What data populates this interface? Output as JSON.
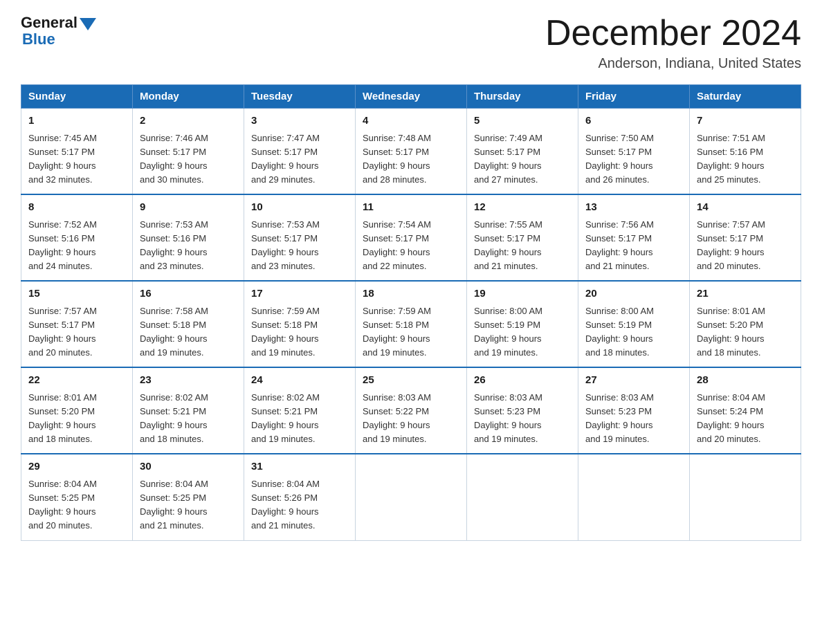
{
  "header": {
    "logo_general": "General",
    "logo_blue": "Blue",
    "month_title": "December 2024",
    "location": "Anderson, Indiana, United States"
  },
  "days_of_week": [
    "Sunday",
    "Monday",
    "Tuesday",
    "Wednesday",
    "Thursday",
    "Friday",
    "Saturday"
  ],
  "weeks": [
    [
      {
        "day": "1",
        "sunrise": "7:45 AM",
        "sunset": "5:17 PM",
        "daylight": "9 hours and 32 minutes."
      },
      {
        "day": "2",
        "sunrise": "7:46 AM",
        "sunset": "5:17 PM",
        "daylight": "9 hours and 30 minutes."
      },
      {
        "day": "3",
        "sunrise": "7:47 AM",
        "sunset": "5:17 PM",
        "daylight": "9 hours and 29 minutes."
      },
      {
        "day": "4",
        "sunrise": "7:48 AM",
        "sunset": "5:17 PM",
        "daylight": "9 hours and 28 minutes."
      },
      {
        "day": "5",
        "sunrise": "7:49 AM",
        "sunset": "5:17 PM",
        "daylight": "9 hours and 27 minutes."
      },
      {
        "day": "6",
        "sunrise": "7:50 AM",
        "sunset": "5:17 PM",
        "daylight": "9 hours and 26 minutes."
      },
      {
        "day": "7",
        "sunrise": "7:51 AM",
        "sunset": "5:16 PM",
        "daylight": "9 hours and 25 minutes."
      }
    ],
    [
      {
        "day": "8",
        "sunrise": "7:52 AM",
        "sunset": "5:16 PM",
        "daylight": "9 hours and 24 minutes."
      },
      {
        "day": "9",
        "sunrise": "7:53 AM",
        "sunset": "5:16 PM",
        "daylight": "9 hours and 23 minutes."
      },
      {
        "day": "10",
        "sunrise": "7:53 AM",
        "sunset": "5:17 PM",
        "daylight": "9 hours and 23 minutes."
      },
      {
        "day": "11",
        "sunrise": "7:54 AM",
        "sunset": "5:17 PM",
        "daylight": "9 hours and 22 minutes."
      },
      {
        "day": "12",
        "sunrise": "7:55 AM",
        "sunset": "5:17 PM",
        "daylight": "9 hours and 21 minutes."
      },
      {
        "day": "13",
        "sunrise": "7:56 AM",
        "sunset": "5:17 PM",
        "daylight": "9 hours and 21 minutes."
      },
      {
        "day": "14",
        "sunrise": "7:57 AM",
        "sunset": "5:17 PM",
        "daylight": "9 hours and 20 minutes."
      }
    ],
    [
      {
        "day": "15",
        "sunrise": "7:57 AM",
        "sunset": "5:17 PM",
        "daylight": "9 hours and 20 minutes."
      },
      {
        "day": "16",
        "sunrise": "7:58 AM",
        "sunset": "5:18 PM",
        "daylight": "9 hours and 19 minutes."
      },
      {
        "day": "17",
        "sunrise": "7:59 AM",
        "sunset": "5:18 PM",
        "daylight": "9 hours and 19 minutes."
      },
      {
        "day": "18",
        "sunrise": "7:59 AM",
        "sunset": "5:18 PM",
        "daylight": "9 hours and 19 minutes."
      },
      {
        "day": "19",
        "sunrise": "8:00 AM",
        "sunset": "5:19 PM",
        "daylight": "9 hours and 19 minutes."
      },
      {
        "day": "20",
        "sunrise": "8:00 AM",
        "sunset": "5:19 PM",
        "daylight": "9 hours and 18 minutes."
      },
      {
        "day": "21",
        "sunrise": "8:01 AM",
        "sunset": "5:20 PM",
        "daylight": "9 hours and 18 minutes."
      }
    ],
    [
      {
        "day": "22",
        "sunrise": "8:01 AM",
        "sunset": "5:20 PM",
        "daylight": "9 hours and 18 minutes."
      },
      {
        "day": "23",
        "sunrise": "8:02 AM",
        "sunset": "5:21 PM",
        "daylight": "9 hours and 18 minutes."
      },
      {
        "day": "24",
        "sunrise": "8:02 AM",
        "sunset": "5:21 PM",
        "daylight": "9 hours and 19 minutes."
      },
      {
        "day": "25",
        "sunrise": "8:03 AM",
        "sunset": "5:22 PM",
        "daylight": "9 hours and 19 minutes."
      },
      {
        "day": "26",
        "sunrise": "8:03 AM",
        "sunset": "5:23 PM",
        "daylight": "9 hours and 19 minutes."
      },
      {
        "day": "27",
        "sunrise": "8:03 AM",
        "sunset": "5:23 PM",
        "daylight": "9 hours and 19 minutes."
      },
      {
        "day": "28",
        "sunrise": "8:04 AM",
        "sunset": "5:24 PM",
        "daylight": "9 hours and 20 minutes."
      }
    ],
    [
      {
        "day": "29",
        "sunrise": "8:04 AM",
        "sunset": "5:25 PM",
        "daylight": "9 hours and 20 minutes."
      },
      {
        "day": "30",
        "sunrise": "8:04 AM",
        "sunset": "5:25 PM",
        "daylight": "9 hours and 21 minutes."
      },
      {
        "day": "31",
        "sunrise": "8:04 AM",
        "sunset": "5:26 PM",
        "daylight": "9 hours and 21 minutes."
      },
      null,
      null,
      null,
      null
    ]
  ],
  "labels": {
    "sunrise": "Sunrise:",
    "sunset": "Sunset:",
    "daylight": "Daylight:"
  }
}
